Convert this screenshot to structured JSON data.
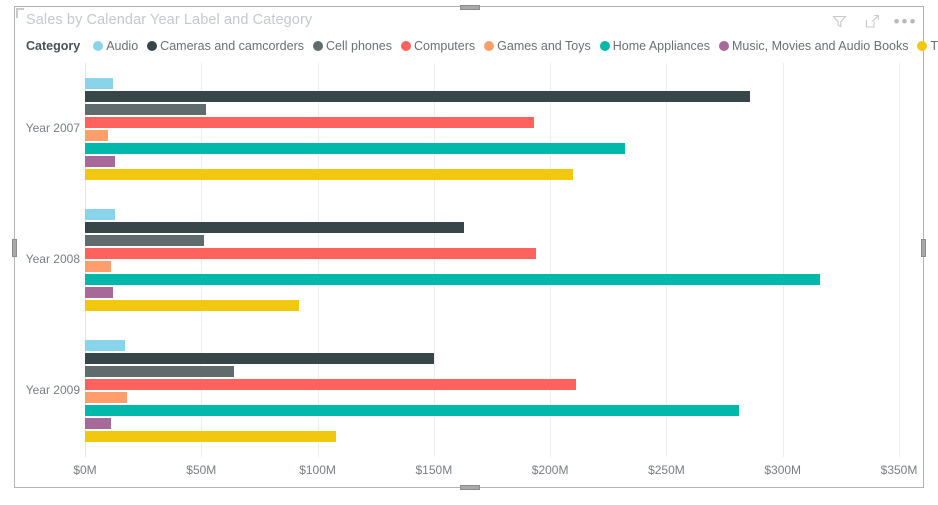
{
  "visual": {
    "title": "Sales by Calendar Year Label and Category",
    "header_icons": [
      {
        "name": "filter-icon",
        "label": "Filters"
      },
      {
        "name": "focus-mode-icon",
        "label": "Focus mode"
      },
      {
        "name": "more-options-icon",
        "label": "More options"
      }
    ],
    "more_options_glyph": "•••"
  },
  "legend": {
    "title": "Category",
    "position": "top",
    "items": [
      {
        "label": "Audio",
        "color": "#8AD4EB"
      },
      {
        "label": "Cameras and camcorders",
        "color": "#374649"
      },
      {
        "label": "Cell phones",
        "color": "#5F6B6D"
      },
      {
        "label": "Computers",
        "color": "#FD625E"
      },
      {
        "label": "Games and Toys",
        "color": "#FF9D6B"
      },
      {
        "label": "Home Appliances",
        "color": "#01B8AA"
      },
      {
        "label": "Music, Movies and Audio Books",
        "color": "#A66999"
      },
      {
        "label": "TV and Video",
        "color": "#F2C80F"
      }
    ]
  },
  "chart_data": {
    "type": "bar",
    "orientation": "horizontal",
    "title": "Sales by Calendar Year Label and Category",
    "xlabel": "",
    "ylabel": "",
    "xlim": [
      0,
      350
    ],
    "xunit": "$M",
    "xticks": [
      0,
      50,
      100,
      150,
      200,
      250,
      300,
      350
    ],
    "xtick_labels": [
      "$0M",
      "$50M",
      "$100M",
      "$150M",
      "$200M",
      "$250M",
      "$300M",
      "$350M"
    ],
    "categories": [
      "Year 2007",
      "Year 2008",
      "Year 2009"
    ],
    "grid": true,
    "legend_position": "top",
    "series": [
      {
        "name": "Audio",
        "color": "#8AD4EB",
        "values": [
          12,
          13,
          17
        ]
      },
      {
        "name": "Cameras and camcorders",
        "color": "#374649",
        "values": [
          286,
          163,
          150
        ]
      },
      {
        "name": "Cell phones",
        "color": "#5F6B6D",
        "values": [
          52,
          51,
          64
        ]
      },
      {
        "name": "Computers",
        "color": "#FD625E",
        "values": [
          193,
          194,
          211
        ]
      },
      {
        "name": "Games and Toys",
        "color": "#FF9D6B",
        "values": [
          10,
          11,
          18
        ]
      },
      {
        "name": "Home Appliances",
        "color": "#01B8AA",
        "values": [
          232,
          316,
          281
        ]
      },
      {
        "name": "Music, Movies and Audio Books",
        "color": "#A66999",
        "values": [
          13,
          12,
          11
        ]
      },
      {
        "name": "TV and Video",
        "color": "#F2C80F",
        "values": [
          210,
          92,
          108
        ]
      }
    ]
  }
}
